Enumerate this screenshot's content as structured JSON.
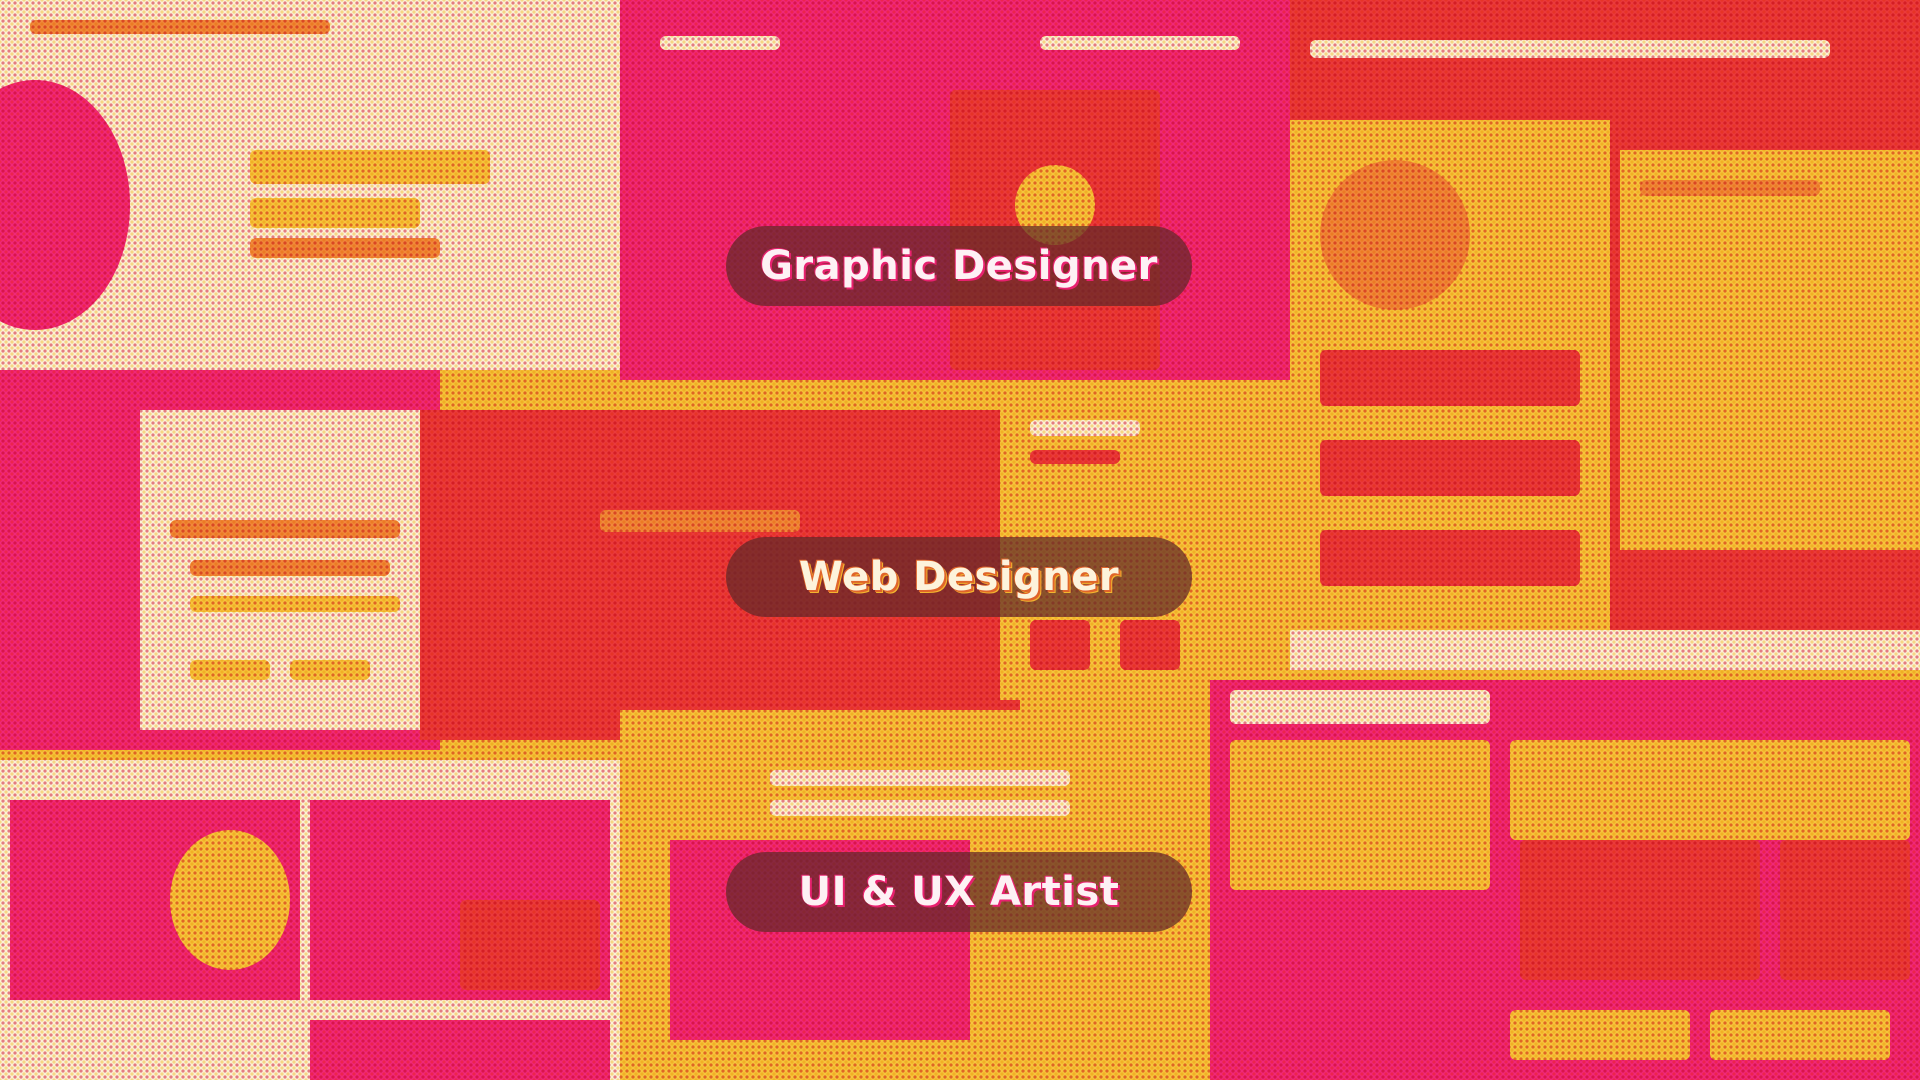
{
  "labels": [
    {
      "text": "Graphic Designer"
    },
    {
      "text": "Web Designer"
    },
    {
      "text": "UI & UX Artist"
    }
  ],
  "colors": {
    "pink": "#f0287a",
    "red": "#ea3a3c",
    "yellow": "#f6c63c",
    "cream": "#fbf1d6",
    "pill_background": "#5f2828"
  }
}
